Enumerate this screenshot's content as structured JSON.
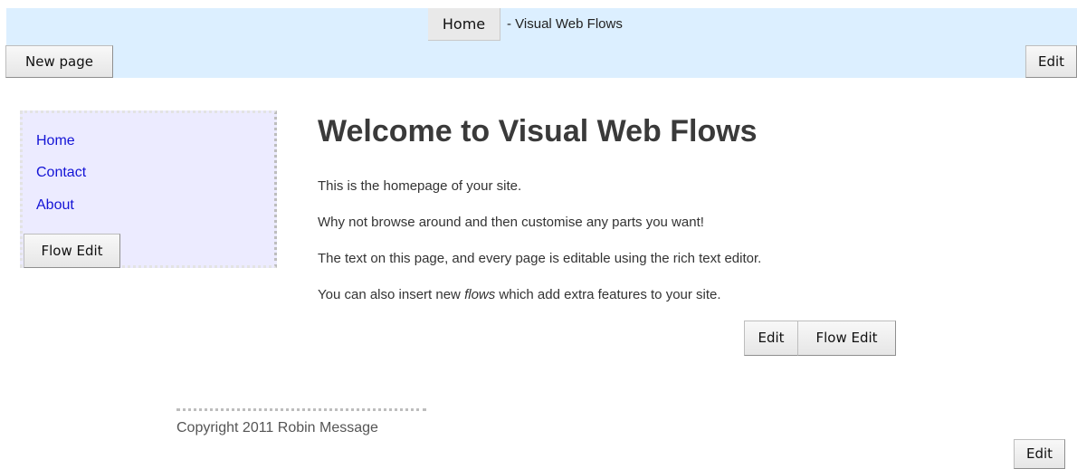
{
  "header": {
    "home_label": "Home",
    "title_suffix": "- Visual Web Flows",
    "new_page_label": "New page",
    "edit_label": "Edit"
  },
  "sidebar": {
    "links": [
      "Home",
      "Contact",
      "About"
    ],
    "flow_edit_label": "Flow Edit"
  },
  "content": {
    "title": "Welcome to Visual Web Flows",
    "paragraph_1": "This is the homepage of your site.",
    "paragraph_2": "Why not browse around and then customise any parts you want!",
    "paragraph_3": "The text on this page, and every page is editable using the rich text editor.",
    "paragraph_4_before": "You can also insert new ",
    "paragraph_4_emphasis": "flows",
    "paragraph_4_after": " which add extra features to your site.",
    "edit_label": "Edit",
    "flow_edit_label": "Flow Edit"
  },
  "footer": {
    "copyright": "Copyright 2011 Robin Message",
    "edit_label": "Edit"
  },
  "colors": {
    "header_background": "#dcefff",
    "sidebar_background": "#ecebff",
    "link": "#1414d6"
  }
}
